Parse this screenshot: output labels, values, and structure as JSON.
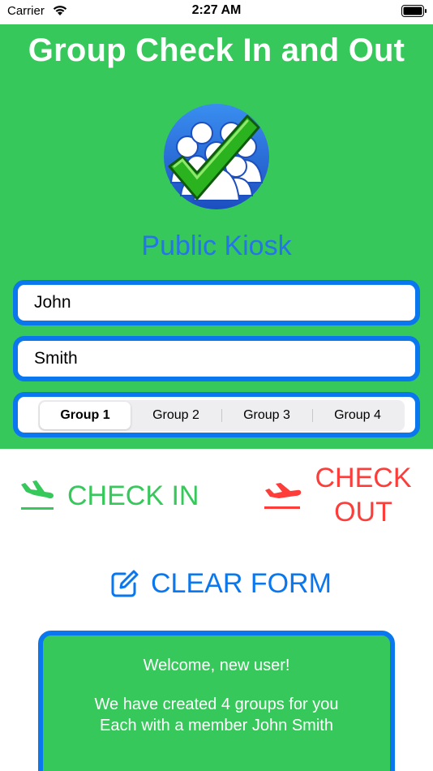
{
  "status_bar": {
    "carrier": "Carrier",
    "time": "2:27 AM",
    "icons": [
      "wifi-icon",
      "battery-icon"
    ]
  },
  "header": {
    "title": "Group Check In and Out",
    "logo_icon": "group-checkmark-logo-icon",
    "subtitle": "Public Kiosk"
  },
  "form": {
    "first_name": {
      "value": "John",
      "placeholder": ""
    },
    "last_name": {
      "value": "Smith",
      "placeholder": ""
    },
    "groups": {
      "options": [
        "Group 1",
        "Group 2",
        "Group 3",
        "Group 4"
      ],
      "selected": "Group 1"
    }
  },
  "actions": {
    "check_in": {
      "label": "CHECK IN",
      "icon": "plane-departure-icon"
    },
    "check_out": {
      "label_line1": "CHECK",
      "label_line2": "OUT",
      "icon": "plane-departure-icon"
    },
    "clear": {
      "label": "CLEAR FORM",
      "icon": "edit-icon"
    }
  },
  "message": {
    "welcome": "Welcome, new user!",
    "line1": "We have created 4 groups for you",
    "line2": "Each with a member John Smith"
  },
  "colors": {
    "panel_green": "#36c85a",
    "accent_blue": "#0a77ee",
    "subtitle_blue": "#2575e8",
    "checkout_red": "#fc3d39"
  }
}
